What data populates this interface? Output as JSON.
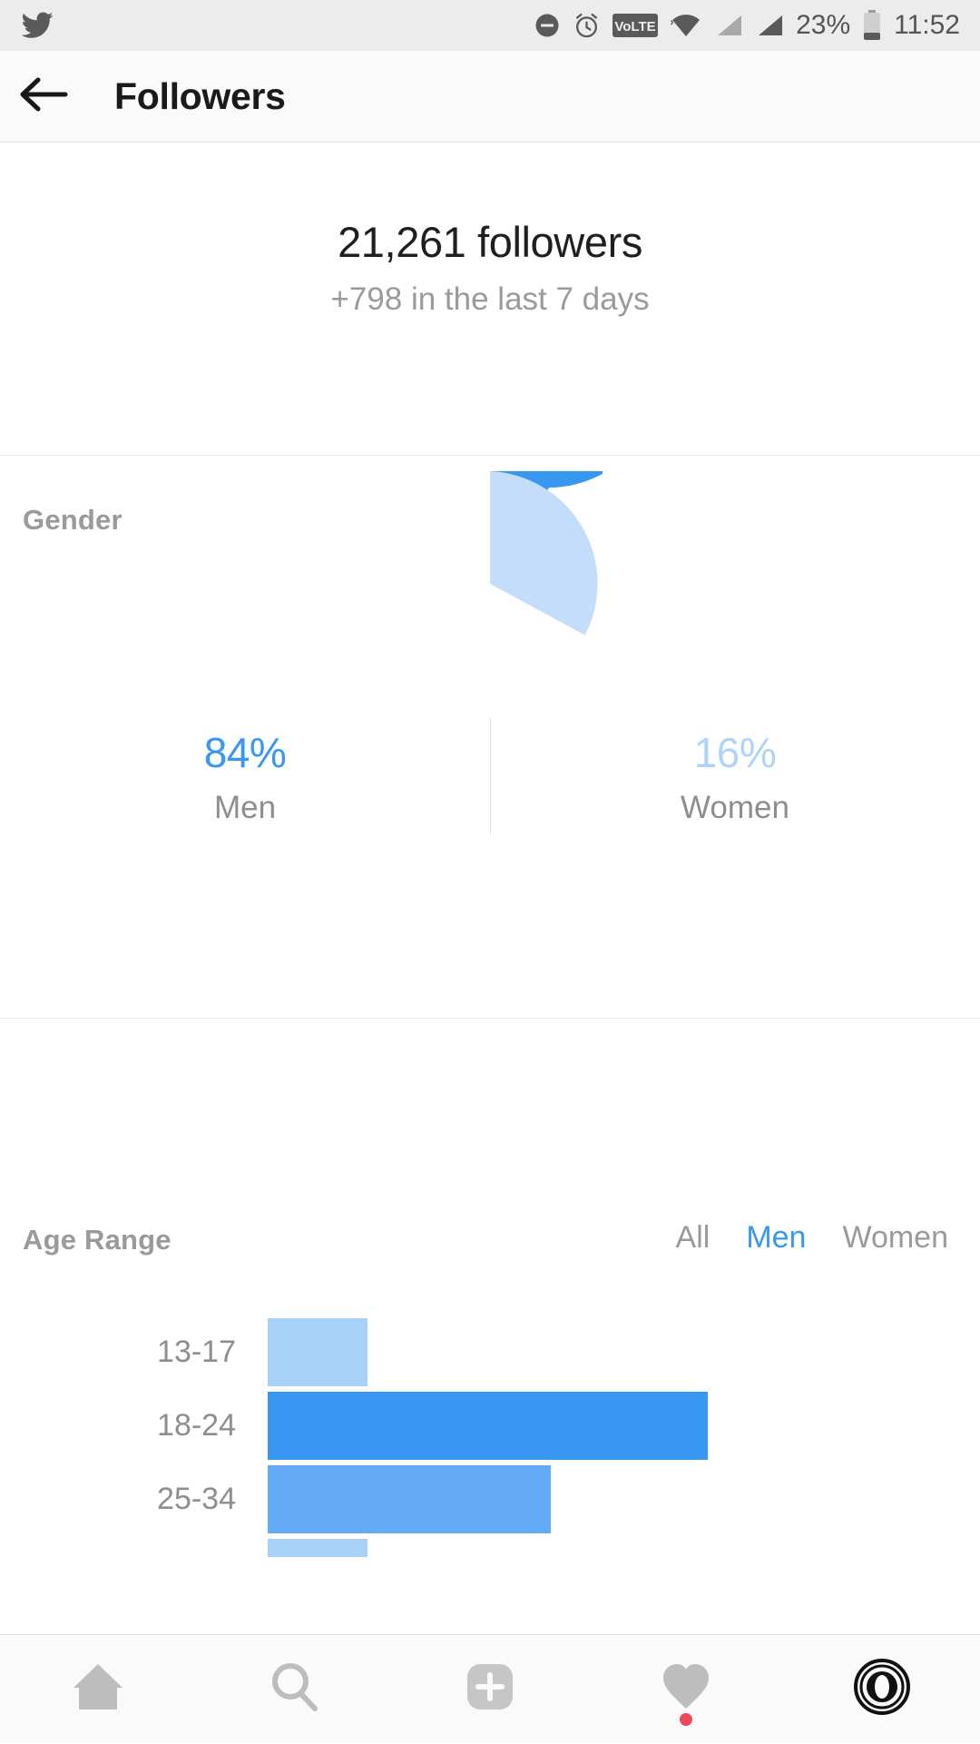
{
  "status_bar": {
    "app_icon": "twitter-bird-icon",
    "icons": [
      "do-not-disturb-icon",
      "alarm-clock-icon",
      "volte-icon",
      "wifi-icon",
      "signal-sim1-icon",
      "signal-sim2-icon"
    ],
    "volte_label": "VoLTE",
    "battery_percent": "23%",
    "time": "11:52"
  },
  "header": {
    "back_icon": "back-arrow-icon",
    "title": "Followers"
  },
  "summary": {
    "count": "21,261 followers",
    "delta": "+798 in the last 7 days"
  },
  "gender": {
    "label": "Gender",
    "men_pct": "84%",
    "men_label": "Men",
    "women_pct": "16%",
    "women_label": "Women"
  },
  "age": {
    "label": "Age Range",
    "tabs": [
      {
        "label": "All",
        "active": false
      },
      {
        "label": "Men",
        "active": true
      },
      {
        "label": "Women",
        "active": false
      }
    ]
  },
  "bottom_nav": [
    {
      "icon": "home-icon",
      "badge": false
    },
    {
      "icon": "search-icon",
      "badge": false
    },
    {
      "icon": "add-post-icon",
      "badge": false
    },
    {
      "icon": "heart-activity-icon",
      "badge": true
    },
    {
      "icon": "profile-camera-icon",
      "badge": false
    }
  ],
  "colors": {
    "primary_blue": "#3897f0",
    "light_blue": "#aed4fa",
    "mid_blue": "#62aaf3",
    "gray_text": "#8e8e8e",
    "badge_red": "#ed4956"
  },
  "chart_data": [
    {
      "type": "pie",
      "title": "Gender",
      "categories": [
        "Men",
        "Women"
      ],
      "values": [
        84,
        16
      ],
      "unit": "%",
      "colors": [
        "#3897f0",
        "#c3ddfb"
      ],
      "start_angle_deg": 0,
      "direction": "clockwise",
      "legend": "below",
      "labels": [
        "84% Men",
        "16% Women"
      ]
    },
    {
      "type": "bar",
      "orientation": "horizontal",
      "title": "Age Range",
      "selected_segment": "Men",
      "categories": [
        "13-17",
        "18-24",
        "25-34"
      ],
      "values": [
        23,
        100,
        64
      ],
      "bar_colors": [
        "#a8d1fa",
        "#3897f0",
        "#62aaf3"
      ],
      "xlabel": "",
      "ylabel": "",
      "xlim": [
        0,
        100
      ],
      "grid": false,
      "note": "values are relative bar lengths as a percentage of the widest bar; chart is cut off below 25-34"
    }
  ]
}
